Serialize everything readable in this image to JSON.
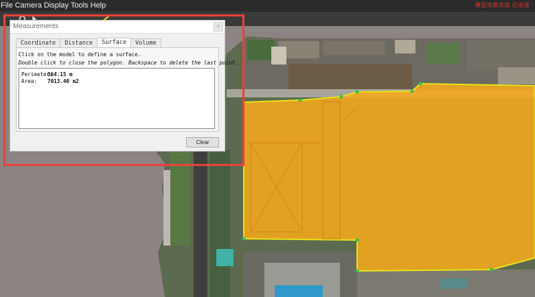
{
  "menu": {
    "items": [
      "File",
      "Camera",
      "Display",
      "Tools",
      "Help"
    ],
    "status_text": "模型加载完成 已连接"
  },
  "dialog": {
    "title": "Measurements",
    "tabs": [
      "Coordinate",
      "Distance",
      "Surface",
      "Volume"
    ],
    "active_tab": "Surface",
    "instruction": "Click on the model to define a surface.",
    "hint": "Double click to close the polygon. Backspace to delete the last point.",
    "perimeter_label": "Perimeter:",
    "perimeter_value": "364.15 m",
    "area_label": "Area:",
    "area_value": "7013.40 m2",
    "clear_label": "Clear"
  },
  "colors": {
    "highlight": "#e8423c",
    "polygon_fill": "#f5a81e",
    "polygon_edge": "#e6e21a",
    "vertex": "#33c24a"
  }
}
